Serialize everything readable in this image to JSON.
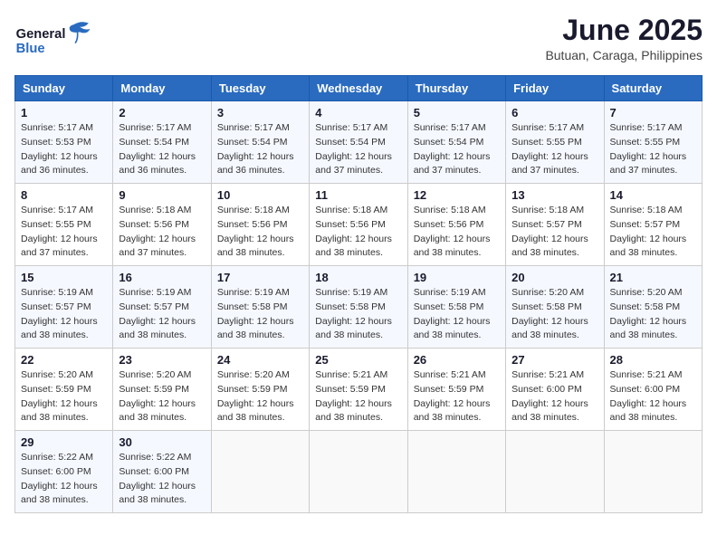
{
  "header": {
    "logo_text_general": "General",
    "logo_text_blue": "Blue",
    "month_year": "June 2025",
    "location": "Butuan, Caraga, Philippines"
  },
  "calendar": {
    "days_of_week": [
      "Sunday",
      "Monday",
      "Tuesday",
      "Wednesday",
      "Thursday",
      "Friday",
      "Saturday"
    ],
    "weeks": [
      [
        {
          "day": "",
          "info": ""
        },
        {
          "day": "",
          "info": ""
        },
        {
          "day": "",
          "info": ""
        },
        {
          "day": "",
          "info": ""
        },
        {
          "day": "",
          "info": ""
        },
        {
          "day": "",
          "info": ""
        },
        {
          "day": "",
          "info": ""
        }
      ],
      [
        {
          "day": "1",
          "info": "Sunrise: 5:17 AM\nSunset: 5:53 PM\nDaylight: 12 hours\nand 36 minutes."
        },
        {
          "day": "2",
          "info": "Sunrise: 5:17 AM\nSunset: 5:54 PM\nDaylight: 12 hours\nand 36 minutes."
        },
        {
          "day": "3",
          "info": "Sunrise: 5:17 AM\nSunset: 5:54 PM\nDaylight: 12 hours\nand 36 minutes."
        },
        {
          "day": "4",
          "info": "Sunrise: 5:17 AM\nSunset: 5:54 PM\nDaylight: 12 hours\nand 37 minutes."
        },
        {
          "day": "5",
          "info": "Sunrise: 5:17 AM\nSunset: 5:54 PM\nDaylight: 12 hours\nand 37 minutes."
        },
        {
          "day": "6",
          "info": "Sunrise: 5:17 AM\nSunset: 5:55 PM\nDaylight: 12 hours\nand 37 minutes."
        },
        {
          "day": "7",
          "info": "Sunrise: 5:17 AM\nSunset: 5:55 PM\nDaylight: 12 hours\nand 37 minutes."
        }
      ],
      [
        {
          "day": "8",
          "info": "Sunrise: 5:17 AM\nSunset: 5:55 PM\nDaylight: 12 hours\nand 37 minutes."
        },
        {
          "day": "9",
          "info": "Sunrise: 5:18 AM\nSunset: 5:56 PM\nDaylight: 12 hours\nand 37 minutes."
        },
        {
          "day": "10",
          "info": "Sunrise: 5:18 AM\nSunset: 5:56 PM\nDaylight: 12 hours\nand 38 minutes."
        },
        {
          "day": "11",
          "info": "Sunrise: 5:18 AM\nSunset: 5:56 PM\nDaylight: 12 hours\nand 38 minutes."
        },
        {
          "day": "12",
          "info": "Sunrise: 5:18 AM\nSunset: 5:56 PM\nDaylight: 12 hours\nand 38 minutes."
        },
        {
          "day": "13",
          "info": "Sunrise: 5:18 AM\nSunset: 5:57 PM\nDaylight: 12 hours\nand 38 minutes."
        },
        {
          "day": "14",
          "info": "Sunrise: 5:18 AM\nSunset: 5:57 PM\nDaylight: 12 hours\nand 38 minutes."
        }
      ],
      [
        {
          "day": "15",
          "info": "Sunrise: 5:19 AM\nSunset: 5:57 PM\nDaylight: 12 hours\nand 38 minutes."
        },
        {
          "day": "16",
          "info": "Sunrise: 5:19 AM\nSunset: 5:57 PM\nDaylight: 12 hours\nand 38 minutes."
        },
        {
          "day": "17",
          "info": "Sunrise: 5:19 AM\nSunset: 5:58 PM\nDaylight: 12 hours\nand 38 minutes."
        },
        {
          "day": "18",
          "info": "Sunrise: 5:19 AM\nSunset: 5:58 PM\nDaylight: 12 hours\nand 38 minutes."
        },
        {
          "day": "19",
          "info": "Sunrise: 5:19 AM\nSunset: 5:58 PM\nDaylight: 12 hours\nand 38 minutes."
        },
        {
          "day": "20",
          "info": "Sunrise: 5:20 AM\nSunset: 5:58 PM\nDaylight: 12 hours\nand 38 minutes."
        },
        {
          "day": "21",
          "info": "Sunrise: 5:20 AM\nSunset: 5:58 PM\nDaylight: 12 hours\nand 38 minutes."
        }
      ],
      [
        {
          "day": "22",
          "info": "Sunrise: 5:20 AM\nSunset: 5:59 PM\nDaylight: 12 hours\nand 38 minutes."
        },
        {
          "day": "23",
          "info": "Sunrise: 5:20 AM\nSunset: 5:59 PM\nDaylight: 12 hours\nand 38 minutes."
        },
        {
          "day": "24",
          "info": "Sunrise: 5:20 AM\nSunset: 5:59 PM\nDaylight: 12 hours\nand 38 minutes."
        },
        {
          "day": "25",
          "info": "Sunrise: 5:21 AM\nSunset: 5:59 PM\nDaylight: 12 hours\nand 38 minutes."
        },
        {
          "day": "26",
          "info": "Sunrise: 5:21 AM\nSunset: 5:59 PM\nDaylight: 12 hours\nand 38 minutes."
        },
        {
          "day": "27",
          "info": "Sunrise: 5:21 AM\nSunset: 6:00 PM\nDaylight: 12 hours\nand 38 minutes."
        },
        {
          "day": "28",
          "info": "Sunrise: 5:21 AM\nSunset: 6:00 PM\nDaylight: 12 hours\nand 38 minutes."
        }
      ],
      [
        {
          "day": "29",
          "info": "Sunrise: 5:22 AM\nSunset: 6:00 PM\nDaylight: 12 hours\nand 38 minutes."
        },
        {
          "day": "30",
          "info": "Sunrise: 5:22 AM\nSunset: 6:00 PM\nDaylight: 12 hours\nand 38 minutes."
        },
        {
          "day": "",
          "info": ""
        },
        {
          "day": "",
          "info": ""
        },
        {
          "day": "",
          "info": ""
        },
        {
          "day": "",
          "info": ""
        },
        {
          "day": "",
          "info": ""
        }
      ]
    ]
  }
}
